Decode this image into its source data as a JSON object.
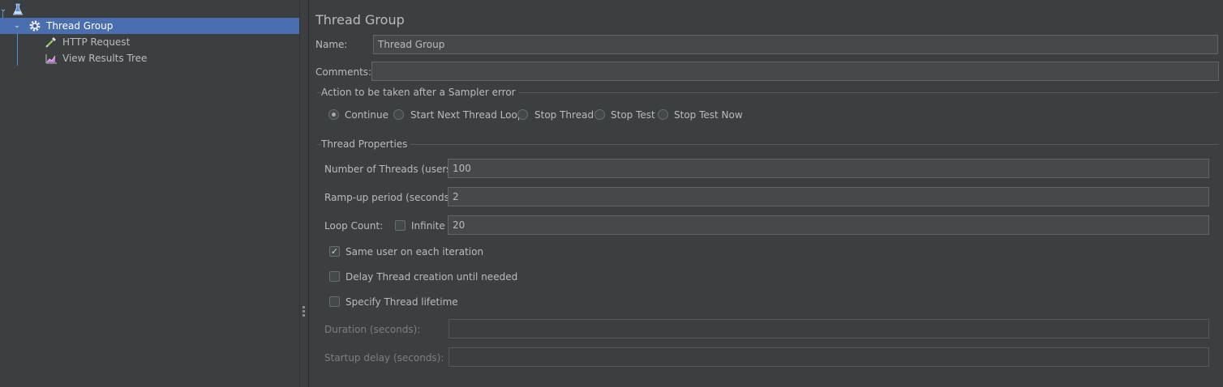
{
  "tree": {
    "root_icon": "flask-icon",
    "items": [
      {
        "label": "Thread Group",
        "icon": "gear-icon",
        "selected": true
      },
      {
        "label": "HTTP Request",
        "icon": "pipette-icon"
      },
      {
        "label": "View Results Tree",
        "icon": "chart-icon"
      }
    ]
  },
  "panel": {
    "title": "Thread Group",
    "name_label": "Name:",
    "name_value": "Thread Group",
    "comments_label": "Comments:",
    "comments_value": ""
  },
  "sampler_error": {
    "title": "Action to be taken after a Sampler error",
    "options": [
      "Continue",
      "Start Next Thread Loop",
      "Stop Thread",
      "Stop Test",
      "Stop Test Now"
    ],
    "selected": "Continue"
  },
  "thread_properties": {
    "title": "Thread Properties",
    "threads_label": "Number of Threads (users):",
    "threads_value": "100",
    "rampup_label": "Ramp-up period (seconds):",
    "rampup_value": "2",
    "loop_label": "Loop Count:",
    "infinite_label": "Infinite",
    "infinite_checked": false,
    "loop_value": "20",
    "same_user_label": "Same user on each iteration",
    "same_user_checked": true,
    "delay_label": "Delay Thread creation until needed",
    "delay_checked": false,
    "lifetime_label": "Specify Thread lifetime",
    "lifetime_checked": false,
    "duration_label": "Duration (seconds):",
    "duration_value": "",
    "startup_label": "Startup delay (seconds):",
    "startup_value": ""
  },
  "colors": {
    "background": "#3c3f41",
    "selection": "#4b6eaf",
    "field": "#45494a",
    "text": "#bbbbbb"
  }
}
